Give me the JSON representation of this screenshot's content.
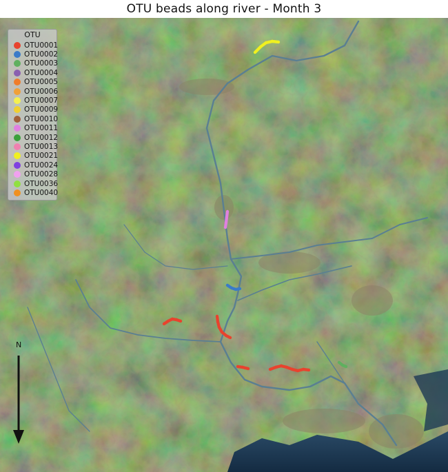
{
  "title": "OTU beads along river - Month 3",
  "legend": {
    "title": "OTU",
    "items": [
      {
        "label": "OTU0001",
        "color": "#e8432e"
      },
      {
        "label": "OTU0002",
        "color": "#3a7bc8"
      },
      {
        "label": "OTU0003",
        "color": "#5fb05f"
      },
      {
        "label": "OTU0004",
        "color": "#8a5fb0"
      },
      {
        "label": "OTU0005",
        "color": "#f07c2a"
      },
      {
        "label": "OTU0006",
        "color": "#f0a038"
      },
      {
        "label": "OTU0007",
        "color": "#f5f050"
      },
      {
        "label": "OTU0009",
        "color": "#f0d030"
      },
      {
        "label": "OTU0010",
        "color": "#a0603a"
      },
      {
        "label": "OTU0011",
        "color": "#e080e0"
      },
      {
        "label": "OTU0012",
        "color": "#3aa03a"
      },
      {
        "label": "OTU0013",
        "color": "#f080b0"
      },
      {
        "label": "OTU0021",
        "color": "#f0f020"
      },
      {
        "label": "OTU0024",
        "color": "#8040e0"
      },
      {
        "label": "OTU0028",
        "color": "#f0a0f0"
      },
      {
        "label": "OTU0036",
        "color": "#90e040"
      },
      {
        "label": "OTU0040",
        "color": "#f09020"
      }
    ]
  },
  "north_label": "N",
  "map": {
    "land_color": "#2f4a2a",
    "water_color": "#1b3550",
    "river_color": "#5a7f92"
  }
}
